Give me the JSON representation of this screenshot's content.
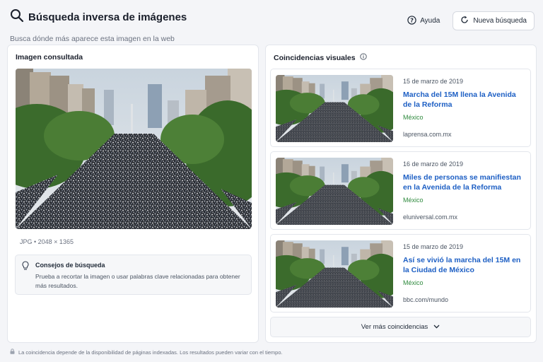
{
  "header": {
    "title": "Búsqueda inversa de imágenes",
    "subtitle": "Busca dónde más aparece esta imagen en la web"
  },
  "top_actions": {
    "help_label": "Ayuda",
    "new_search_label": "Nueva búsqueda"
  },
  "query_panel": {
    "title": "Imagen consultada",
    "image_meta": "JPG • 2048 × 1365",
    "tips": {
      "title": "Consejos de búsqueda",
      "body": "Prueba a recortar la imagen o usar palabras clave relacionadas para obtener más resultados."
    }
  },
  "matches_panel": {
    "title": "Coincidencias visuales",
    "more_label": "Ver más coincidencias",
    "items": [
      {
        "date": "15 de marzo de 2019",
        "title": "Marcha del 15M llena la Avenida de la Reforma",
        "country": "México",
        "domain": "laprensa.com.mx"
      },
      {
        "date": "16 de marzo de 2019",
        "title": "Miles de personas se manifiestan en la Avenida de la Reforma",
        "country": "México",
        "domain": "eluniversal.com.mx"
      },
      {
        "date": "15 de marzo de 2019",
        "title": "Así se vivió la marcha del 15M en la Ciudad de México",
        "country": "México",
        "domain": "bbc.com/mundo"
      }
    ]
  },
  "footer": {
    "note": "La coincidencia depende de la disponibilidad de páginas indexadas. Los resultados pueden variar con el tiempo."
  },
  "icons": {
    "title": "search-icon",
    "help": "help-circle-icon",
    "new_search": "refresh-icon",
    "info": "info-icon",
    "tips": "lightbulb-icon",
    "more": "chevron-down-icon",
    "footer": "lock-icon"
  },
  "colors": {
    "link": "#1d5fc4",
    "country": "#2f8a3e",
    "background": "#f4f5f8"
  }
}
